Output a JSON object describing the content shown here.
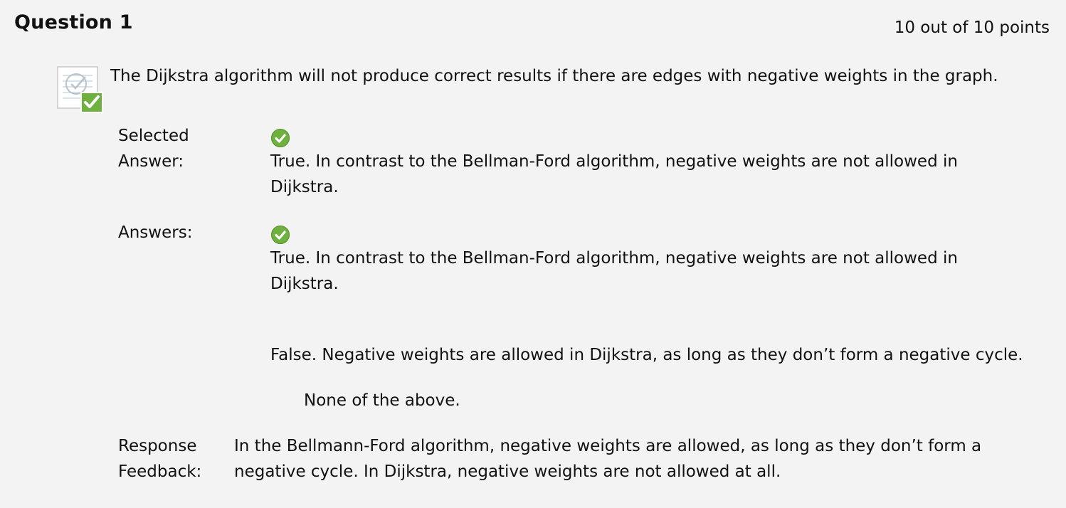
{
  "question": {
    "title": "Question 1",
    "points": "10 out of 10 points",
    "icon": "graded-correct-question-icon",
    "text": "The Dijkstra algorithm will not produce correct results if there are edges with negative weights in the graph."
  },
  "selected_answer": {
    "label_line1": "Selected",
    "label_line2": "Answer:",
    "status_icon": "correct-check-icon",
    "text": "True. In contrast to the Bellman-Ford algorithm, negative weights are not allowed in Dijkstra."
  },
  "answers": {
    "label": "Answers:",
    "items": [
      {
        "text": "True. In contrast to the Bellman-Ford algorithm, negative weights are not allowed in Dijkstra.",
        "correct": true
      },
      {
        "text": "False. Negative weights are allowed in Dijkstra, as long as they don’t form a negative cycle.",
        "correct": false
      },
      {
        "text": "None of the above.",
        "correct": false
      }
    ]
  },
  "feedback": {
    "label_line1": "Response",
    "label_line2": "Feedback:",
    "text": "In the Bellmann-Ford algorithm, negative weights are allowed, as long as they don’t form a negative cycle. In Dijkstra, negative weights are not allowed at all."
  },
  "colors": {
    "background": "#f3f3f3",
    "correct_green": "#6fb13e"
  }
}
